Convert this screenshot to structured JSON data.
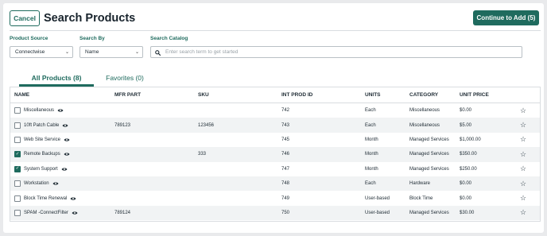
{
  "header": {
    "cancel_label": "Cancel",
    "title": "Search Products",
    "continue_label": "Continue to Add (5)"
  },
  "filters": {
    "product_source": {
      "label": "Product Source",
      "value": "Connectwise"
    },
    "search_by": {
      "label": "Search By",
      "value": "Name"
    },
    "search_catalog": {
      "label": "Search Catalog",
      "placeholder": "Enter search term to get started",
      "value": ""
    }
  },
  "tabs": [
    {
      "label": "All Products (8)",
      "active": true
    },
    {
      "label": "Favorites (0)",
      "active": false
    }
  ],
  "table": {
    "columns": [
      "NAME",
      "MFR PART",
      "SKU",
      "INT PROD ID",
      "UNITS",
      "CATEGORY",
      "UNIT PRICE"
    ],
    "rows": [
      {
        "name": "Miscellaneous",
        "mfr": "",
        "sku": "",
        "int_id": "742",
        "units": "Each",
        "category": "Miscellaneous",
        "price": "$0.00",
        "checked": false
      },
      {
        "name": "10ft Patch Cable",
        "mfr": "789123",
        "sku": "123456",
        "int_id": "743",
        "units": "Each",
        "category": "Miscellaneous",
        "price": "$5.00",
        "checked": false
      },
      {
        "name": "Web Site Service",
        "mfr": "",
        "sku": "",
        "int_id": "745",
        "units": "Month",
        "category": "Managed Services",
        "price": "$1,000.00",
        "checked": false
      },
      {
        "name": "Remote Backups",
        "mfr": "",
        "sku": "333",
        "int_id": "746",
        "units": "Month",
        "category": "Managed Services",
        "price": "$350.00",
        "checked": true
      },
      {
        "name": "System Support",
        "mfr": "",
        "sku": "",
        "int_id": "747",
        "units": "Month",
        "category": "Managed Services",
        "price": "$250.00",
        "checked": true
      },
      {
        "name": "Workstation",
        "mfr": "",
        "sku": "",
        "int_id": "748",
        "units": "Each",
        "category": "Hardware",
        "price": "$0.00",
        "checked": false
      },
      {
        "name": "Block Time Renewal",
        "mfr": "",
        "sku": "",
        "int_id": "749",
        "units": "User-based",
        "category": "Block Time",
        "price": "$0.00",
        "checked": false
      },
      {
        "name": "SPAM -ConnectFilter",
        "mfr": "789124",
        "sku": "",
        "int_id": "750",
        "units": "User-based",
        "category": "Managed Services",
        "price": "$30.00",
        "checked": false
      }
    ]
  },
  "icons": {
    "search": "search-icon",
    "eye": "eye-icon",
    "star": "star-outline-icon",
    "chevron": "chevron-down-icon"
  },
  "colors": {
    "accent": "#1f6b5e",
    "background": "#e9eaec",
    "row_alt": "#f1f3f4"
  }
}
